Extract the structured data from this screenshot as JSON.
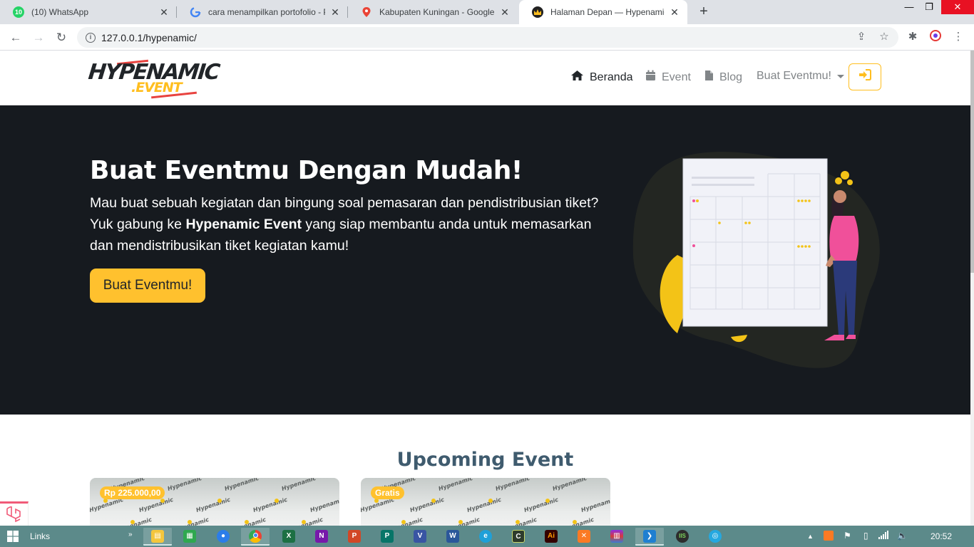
{
  "browser": {
    "tabs": [
      {
        "title": "(10) WhatsApp",
        "favicon": "whatsapp-icon",
        "badge": "10"
      },
      {
        "title": "cara menampilkan portofolio - Pe",
        "favicon": "google-icon"
      },
      {
        "title": "Kabupaten Kuningan - Google M",
        "favicon": "google-maps-icon"
      },
      {
        "title": "Halaman Depan — Hypenamic Sh",
        "favicon": "hypenamic-crown-icon"
      }
    ],
    "active_tab": 3,
    "url": "127.0.0.1/hypenamic/"
  },
  "site": {
    "logo": {
      "line1": "HYPENAMIC",
      "line2": ".EVENT"
    },
    "nav": [
      {
        "label": "Beranda",
        "icon": "home-icon",
        "active": true
      },
      {
        "label": "Event",
        "icon": "calendar-icon"
      },
      {
        "label": "Blog",
        "icon": "file-icon"
      },
      {
        "label": "Buat Eventmu!",
        "dropdown": true
      }
    ],
    "login_icon": "sign-in-icon",
    "accent": "#ffbe1f"
  },
  "hero": {
    "title": "Buat Eventmu Dengan Mudah!",
    "text_before": "Mau buat sebuah kegiatan dan bingung soal pemasaran dan pendistribusian tiket? Yuk gabung ke ",
    "text_bold": "Hypenamic Event",
    "text_after": " yang siap membantu anda untuk memasarkan dan mendistribusikan tiket kegiatan kamu!",
    "cta": "Buat Eventmu!",
    "background": "#161a1f"
  },
  "upcoming": {
    "title": "Upcoming Event",
    "cards": [
      {
        "price": "Rp 225.000,00"
      },
      {
        "price": "Gratis"
      }
    ]
  },
  "taskbar": {
    "links_label": "Links",
    "time": "20:52",
    "apps": [
      "file-explorer",
      "excel-green",
      "firefox",
      "chrome",
      "excel",
      "onenote",
      "powerpoint",
      "publisher",
      "visio",
      "word",
      "edge",
      "cpu-z",
      "illustrator",
      "xampp",
      "winrar",
      "vscode",
      "ms-app",
      "globe-app"
    ]
  }
}
